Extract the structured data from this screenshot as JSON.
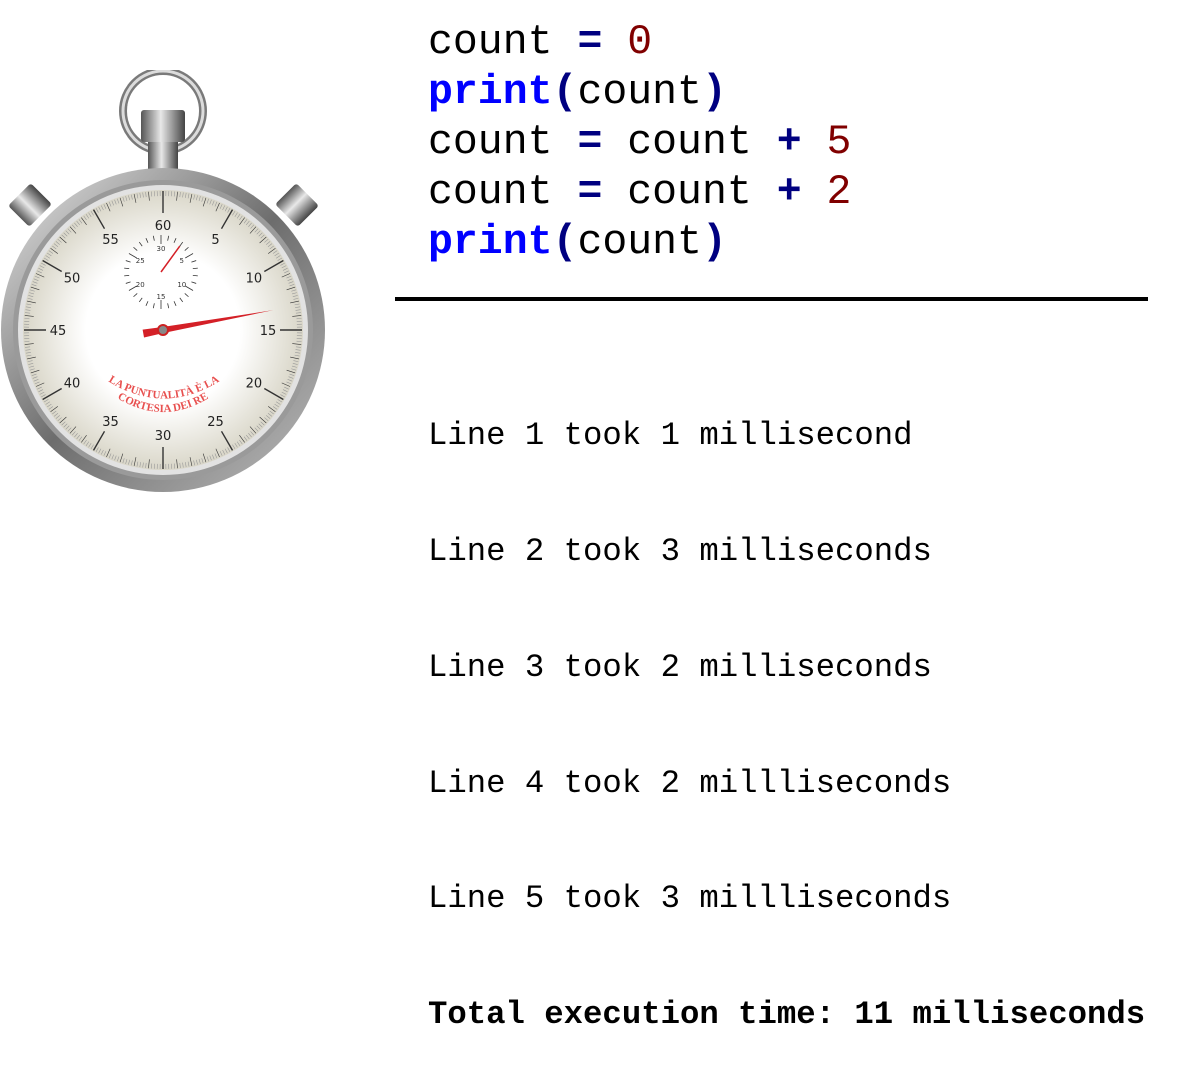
{
  "code": {
    "lines": [
      [
        {
          "t": "count ",
          "c": ""
        },
        {
          "t": "=",
          "c": "op"
        },
        {
          "t": " ",
          "c": ""
        },
        {
          "t": "0",
          "c": "num"
        }
      ],
      [
        {
          "t": "print",
          "c": "kw"
        },
        {
          "t": "(",
          "c": "op"
        },
        {
          "t": "count",
          "c": ""
        },
        {
          "t": ")",
          "c": "op"
        }
      ],
      [
        {
          "t": "count ",
          "c": ""
        },
        {
          "t": "=",
          "c": "op"
        },
        {
          "t": " count ",
          "c": ""
        },
        {
          "t": "+",
          "c": "op"
        },
        {
          "t": " ",
          "c": ""
        },
        {
          "t": "5",
          "c": "num"
        }
      ],
      [
        {
          "t": "count ",
          "c": ""
        },
        {
          "t": "=",
          "c": "op"
        },
        {
          "t": " count ",
          "c": ""
        },
        {
          "t": "+",
          "c": "op"
        },
        {
          "t": " ",
          "c": ""
        },
        {
          "t": "2",
          "c": "num"
        }
      ],
      [
        {
          "t": "print",
          "c": "kw"
        },
        {
          "t": "(",
          "c": "op"
        },
        {
          "t": "count",
          "c": ""
        },
        {
          "t": ")",
          "c": "op"
        }
      ]
    ]
  },
  "output": {
    "lines": [
      "Line 1 took 1 millisecond",
      "Line 2 took 3 milliseconds",
      "Line 3 took 2 milliseconds",
      "Line 4 took 2 millliseconds",
      "Line 5 took 3 millliseconds"
    ],
    "total": "Total execution time: 11 milliseconds"
  },
  "stopwatch": {
    "dial_labels": [
      "60",
      "5",
      "10",
      "15",
      "20",
      "25",
      "30",
      "35",
      "40",
      "45",
      "50",
      "55"
    ],
    "subdial_labels": [
      "30",
      "5",
      "10",
      "15",
      "20",
      "25"
    ],
    "motto_line1": "LA PUNTUALITÀ È LA",
    "motto_line2": "CORTESIA DEI RE",
    "seconds_hand_value": 13.3,
    "subdial_hand_value": 3,
    "colors": {
      "hand": "#d42027",
      "motto": "#e8504f"
    }
  },
  "colors": {
    "operator": "#000080",
    "keyword": "#0000ff",
    "number": "#800000"
  }
}
